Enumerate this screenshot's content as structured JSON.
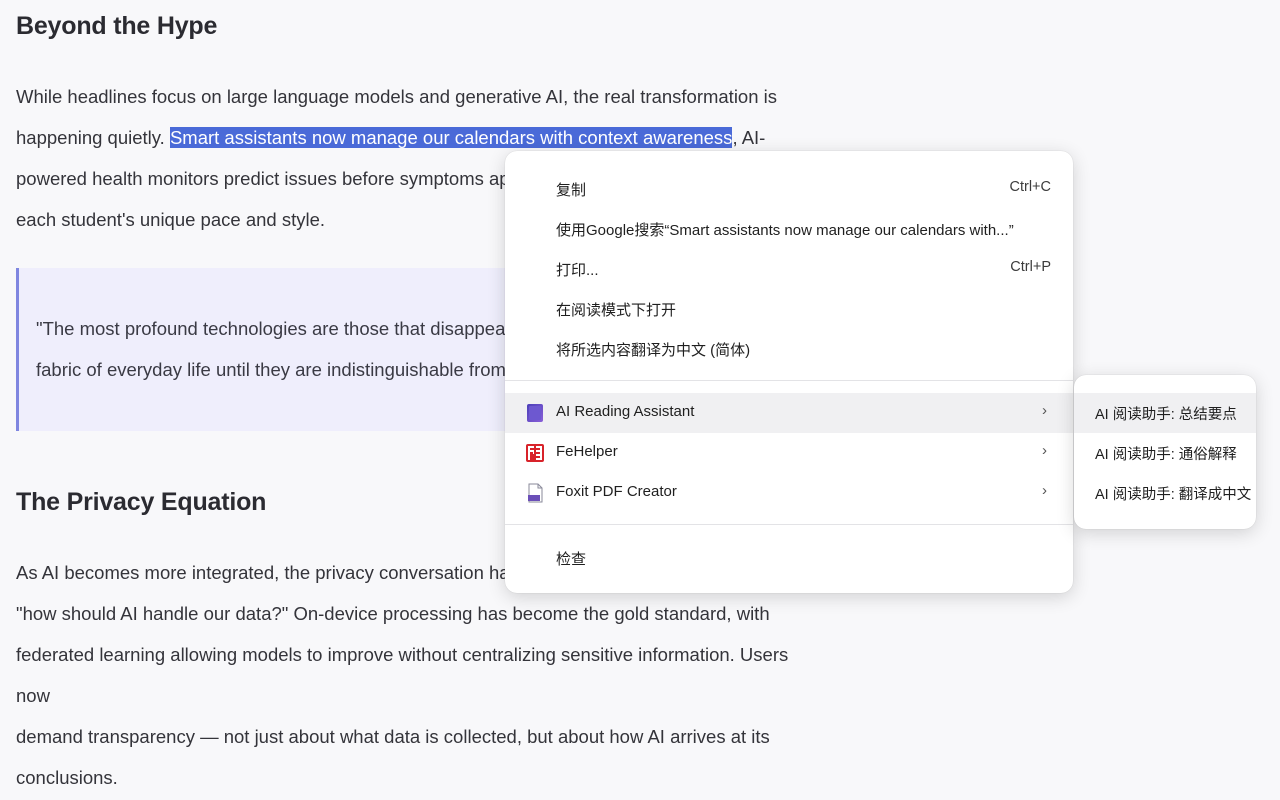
{
  "article": {
    "heading1": "Beyond the Hype",
    "para1": {
      "before": "While headlines focus on large language models and generative AI, the real transformation is happening quietly. ",
      "selected": "Smart assistants now manage our calendars with context awareness",
      "after": ", AI-powered health monitors predict issues before symptoms appear, and per",
      "line4": "each student's unique pace and style."
    },
    "quote": {
      "line1": "\"The most profound technologies are those that disappear. Th",
      "line2": "fabric of everyday life until they are indistinguishable from it.\""
    },
    "heading2": "The Privacy Equation",
    "para2": {
      "line1": "As AI becomes more integrated, the privacy conversation has shi",
      "line2": "\"how should AI handle our data?\" On-device processing has become the gold standard, with",
      "line3": "federated learning allowing models to improve without centralizing sensitive information. Users now",
      "line4": "demand transparency — not just about what data is collected, but about how AI arrives at its",
      "line5": "conclusions."
    }
  },
  "context_menu": {
    "items": [
      {
        "label": "复制",
        "shortcut": "Ctrl+C"
      },
      {
        "label": "使用Google搜索“Smart assistants now manage our calendars with...”",
        "shortcut": ""
      },
      {
        "label": "打印...",
        "shortcut": "Ctrl+P"
      },
      {
        "label": "在阅读模式下打开",
        "shortcut": ""
      },
      {
        "label": "将所选内容翻译为中文 (简体)",
        "shortcut": ""
      }
    ],
    "extensions": [
      {
        "label": "AI Reading Assistant",
        "icon": "ai-reading-assistant-icon",
        "arrow": "›"
      },
      {
        "label": "FeHelper",
        "icon": "fehelper-icon",
        "arrow": "›"
      },
      {
        "label": "Foxit PDF Creator",
        "icon": "foxit-pdf-icon",
        "arrow": "›"
      }
    ],
    "inspect": "检查"
  },
  "submenu": {
    "items": [
      {
        "label": "AI 阅读助手: 总结要点"
      },
      {
        "label": "AI 阅读助手: 通俗解释"
      },
      {
        "label": "AI 阅读助手: 翻译成中文"
      }
    ]
  },
  "colors": {
    "selection": "#4a6ad8",
    "quote_bg": "#efeefc",
    "quote_border": "#7f86e0"
  }
}
